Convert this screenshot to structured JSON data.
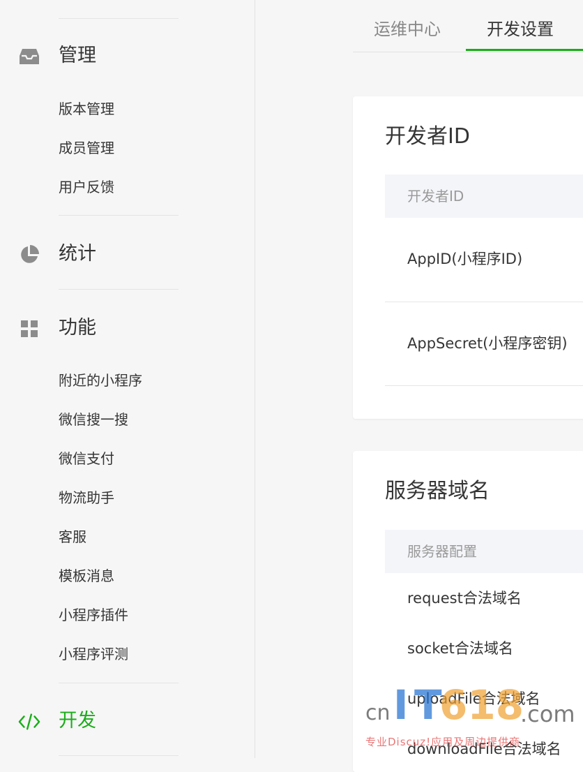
{
  "sidebar": {
    "manage": {
      "title": "管理",
      "icon": "inbox-icon",
      "items": [
        "版本管理",
        "成员管理",
        "用户反馈"
      ]
    },
    "stats": {
      "title": "统计",
      "icon": "pie-chart-icon"
    },
    "features": {
      "title": "功能",
      "icon": "grid-icon",
      "items": [
        "附近的小程序",
        "微信搜一搜",
        "微信支付",
        "物流助手",
        "客服",
        "模板消息",
        "小程序插件",
        "小程序评测"
      ]
    },
    "develop": {
      "title": "开发",
      "icon": "code-icon",
      "active_color": "#1aad19"
    }
  },
  "tabs": [
    {
      "label": "运维中心",
      "active": false
    },
    {
      "label": "开发设置",
      "active": true
    }
  ],
  "developer_id": {
    "title": "开发者ID",
    "header": "开发者ID",
    "rows": [
      "AppID(小程序ID)",
      "AppSecret(小程序密钥)"
    ]
  },
  "server_domain": {
    "title": "服务器域名",
    "header": "服务器配置",
    "rows": [
      "request合法域名",
      "socket合法域名",
      "uploadFile合法域名",
      "downloadFile合法域名"
    ]
  },
  "watermark": {
    "prefix": "cn",
    "brand_i": "I",
    "brand_t": "T",
    "brand_num": "618",
    "suffix": ".com",
    "tagline": "专业Discuz!应用及周边提供商"
  },
  "colors": {
    "accent": "#1aad19",
    "text": "#353535",
    "muted": "#888888"
  }
}
